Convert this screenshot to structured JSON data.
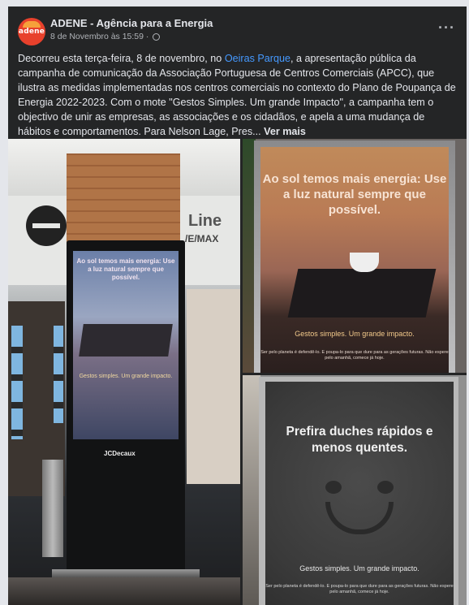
{
  "post": {
    "page_name": "ADENE - Agência para a Energia",
    "avatar_text": "adene",
    "timestamp": "8 de Novembro às 15:59 ·",
    "more_label": "···",
    "text_part1": "Decorreu esta terça-feira, 8 de novembro, no ",
    "link_text": "Oeiras Parque",
    "text_part2": ", a apresentação pública da campanha de comunicação da Associação Portuguesa de Centros Comerciais (APCC), que ilustra as medidas implementadas nos centros comerciais no contexto do Plano de Poupança de Energia 2022-2023. Com o mote \"Gestos Simples. Um grande Impacto\", a campanha tem o objectivo de unir as empresas, as associações e os cidadãos, e apela a uma mudança de hábitos e comportamentos. Para Nelson Lage, Pres... ",
    "see_more": "Ver mais"
  },
  "photos": {
    "kiosk": {
      "title": "Ao sol temos mais energia: Use a luz natural sempre que possível.",
      "subtitle": "Gestos simples. Um grande impacto.",
      "brand": "JCDecaux"
    },
    "store_sign": {
      "line1": "Line",
      "line2": "/E/MAX"
    },
    "poster_sun": {
      "title": "Ao sol temos mais energia: Use a luz natural sempre que possível.",
      "subtitle": "Gestos simples. Um grande impacto.",
      "small": "Ser pelo planeta é defendê-lo. E poupa-lo para que dure para as gerações futuras. Não espere pelo amanhã, comece já hoje."
    },
    "poster_shower": {
      "title": "Prefira duches rápidos e menos quentes.",
      "subtitle": "Gestos simples. Um grande impacto.",
      "small": "Ser pelo planeta é defendê-lo. E poupa-lo para que dure para as gerações futuras. Não espere pelo amanhã, comece já hoje."
    }
  }
}
